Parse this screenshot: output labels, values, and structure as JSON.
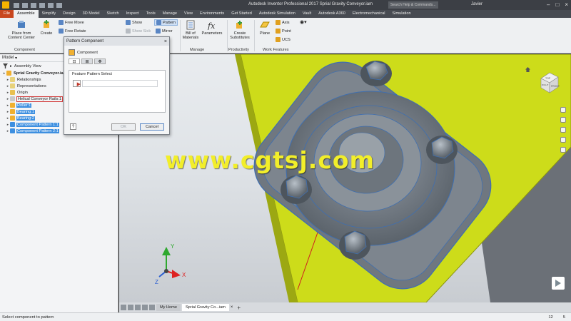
{
  "titlebar": {
    "title": "Autodesk Inventor Professional 2017    Sprial Gravity Conveyor.iam",
    "search_placeholder": "Search Help & Commands...",
    "user": "Javier"
  },
  "tabs": [
    "File",
    "Assemble",
    "Simplify",
    "Design",
    "3D Model",
    "Sketch",
    "Inspect",
    "Tools",
    "Manage",
    "View",
    "Environments",
    "Get Started",
    "Autodesk Simulation",
    "Vault",
    "Autodesk A360",
    "Electromechanical",
    "Simulation"
  ],
  "ribbon": {
    "place": "Place from\nContent Center",
    "create": "Create",
    "free_move": "Free Move",
    "free_rotate": "Free Rotate",
    "show": "Show",
    "show_sick": "Show Sick",
    "pattern": "Pattern",
    "mirror": "Mirror",
    "bill": "Bill of\nMaterials",
    "parameters": "Parameters",
    "create_substitutes": "Create\nSubstitutes",
    "plane": "Plane",
    "axis": "Axis",
    "point": "Point",
    "ucs": "UCS",
    "groups": {
      "component": "Component",
      "manage": "Manage",
      "productivity": "Productivity",
      "work_features": "Work Features"
    }
  },
  "browser": {
    "title": "Model",
    "view": "Assembly View",
    "items": [
      {
        "label": "Sprial Gravity Conveyor.iam",
        "icon": "assembly-icon"
      },
      {
        "label": "Relationships",
        "icon": "relationships-icon"
      },
      {
        "label": "Representations",
        "icon": "representations-icon"
      },
      {
        "label": "Origin",
        "icon": "folder-icon"
      },
      {
        "label": "Helical Conveyor Rails:1",
        "icon": "part-icon"
      },
      {
        "label": "Roller:1",
        "icon": "part-icon"
      },
      {
        "label": "Bearing:1",
        "icon": "part-icon"
      },
      {
        "label": "Bearing:2",
        "icon": "part-icon"
      },
      {
        "label": "Component Pattern 1:1",
        "icon": "pattern-icon"
      },
      {
        "label": "Component Pattern 2:1",
        "icon": "pattern-icon"
      }
    ]
  },
  "dialog": {
    "title": "Pattern Component",
    "component_label": "Component",
    "feature_label": "Feature Pattern Select",
    "ok": "OK",
    "cancel": "Cancel",
    "help": "?"
  },
  "viewcube": {
    "top": "TOP",
    "front": "FRONT",
    "right": "RIGHT"
  },
  "watermark": "www.cgtsj.com",
  "doc_tabs": {
    "home": "My Home",
    "active": "Sprial Gravity Co...iam"
  },
  "statusbar": {
    "message": "Select component to pattern",
    "n1": "12",
    "n2": "5"
  },
  "colors": {
    "accent": "#3d8fe0",
    "plate": "#cddc1a",
    "file_tab": "#c8461e",
    "watermark": "#f2ee2a"
  }
}
